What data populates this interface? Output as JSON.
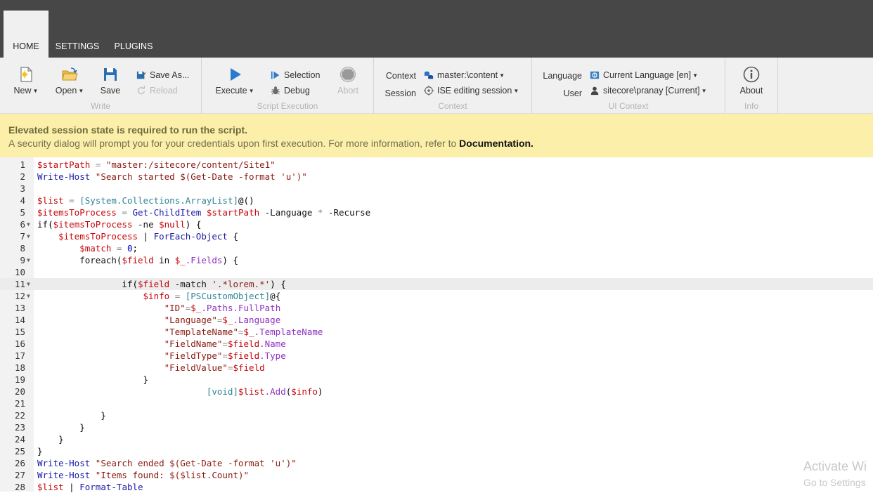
{
  "tabs": [
    {
      "label": "HOME",
      "active": true
    },
    {
      "label": "SETTINGS",
      "active": false
    },
    {
      "label": "PLUGINS",
      "active": false
    }
  ],
  "ribbon": {
    "write": {
      "group_label": "Write",
      "new_label": "New",
      "open_label": "Open",
      "save_label": "Save",
      "save_as_label": "Save As...",
      "reload_label": "Reload"
    },
    "script_execution": {
      "group_label": "Script Execution",
      "execute_label": "Execute",
      "selection_label": "Selection",
      "debug_label": "Debug",
      "abort_label": "Abort"
    },
    "context": {
      "group_label": "Context",
      "context_label": "Context",
      "context_value": "master:\\content",
      "session_label": "Session",
      "session_value": "ISE editing session"
    },
    "ui_context": {
      "group_label": "UI Context",
      "language_label": "Language",
      "language_value": "Current Language [en]",
      "user_label": "User",
      "user_value": "sitecore\\pranay [Current]"
    },
    "info": {
      "group_label": "Info",
      "about_label": "About"
    }
  },
  "banner": {
    "title": "Elevated session state is required to run the script.",
    "message": "A security dialog will prompt you for your credentials upon first execution. For more information, refer to ",
    "link": "Documentation."
  },
  "editor": {
    "lines": [
      "$startPath = \"master:/sitecore/content/Site1\"",
      "Write-Host \"Search started $(Get-Date -format 'u')\"",
      "",
      "$list = [System.Collections.ArrayList]@()",
      "$itemsToProcess = Get-ChildItem $startPath -Language * -Recurse",
      "if($itemsToProcess -ne $null) {",
      "    $itemsToProcess | ForEach-Object {",
      "        $match = 0;",
      "        foreach($field in $_.Fields) {",
      "",
      "                if($field -match '.*lorem.*') {",
      "                    $info = [PSCustomObject]@{",
      "                        \"ID\"=$_.Paths.FullPath",
      "                        \"Language\"=$_.Language",
      "                        \"TemplateName\"=$_.TemplateName",
      "                        \"FieldName\"=$field.Name",
      "                        \"FieldType\"=$field.Type",
      "                        \"FieldValue\"=$field",
      "                    }",
      "                                [void]$list.Add($info)",
      "",
      "            }",
      "        }",
      "    }",
      "}",
      "Write-Host \"Search ended $(Get-Date -format 'u')\"",
      "Write-Host \"Items found: $($list.Count)\"",
      "$list | Format-Table"
    ],
    "fold_lines": [
      6,
      7,
      9,
      11,
      12
    ],
    "active_line": 11
  },
  "watermark": {
    "line1": "Activate Wi",
    "line2": "Go to Settings"
  }
}
